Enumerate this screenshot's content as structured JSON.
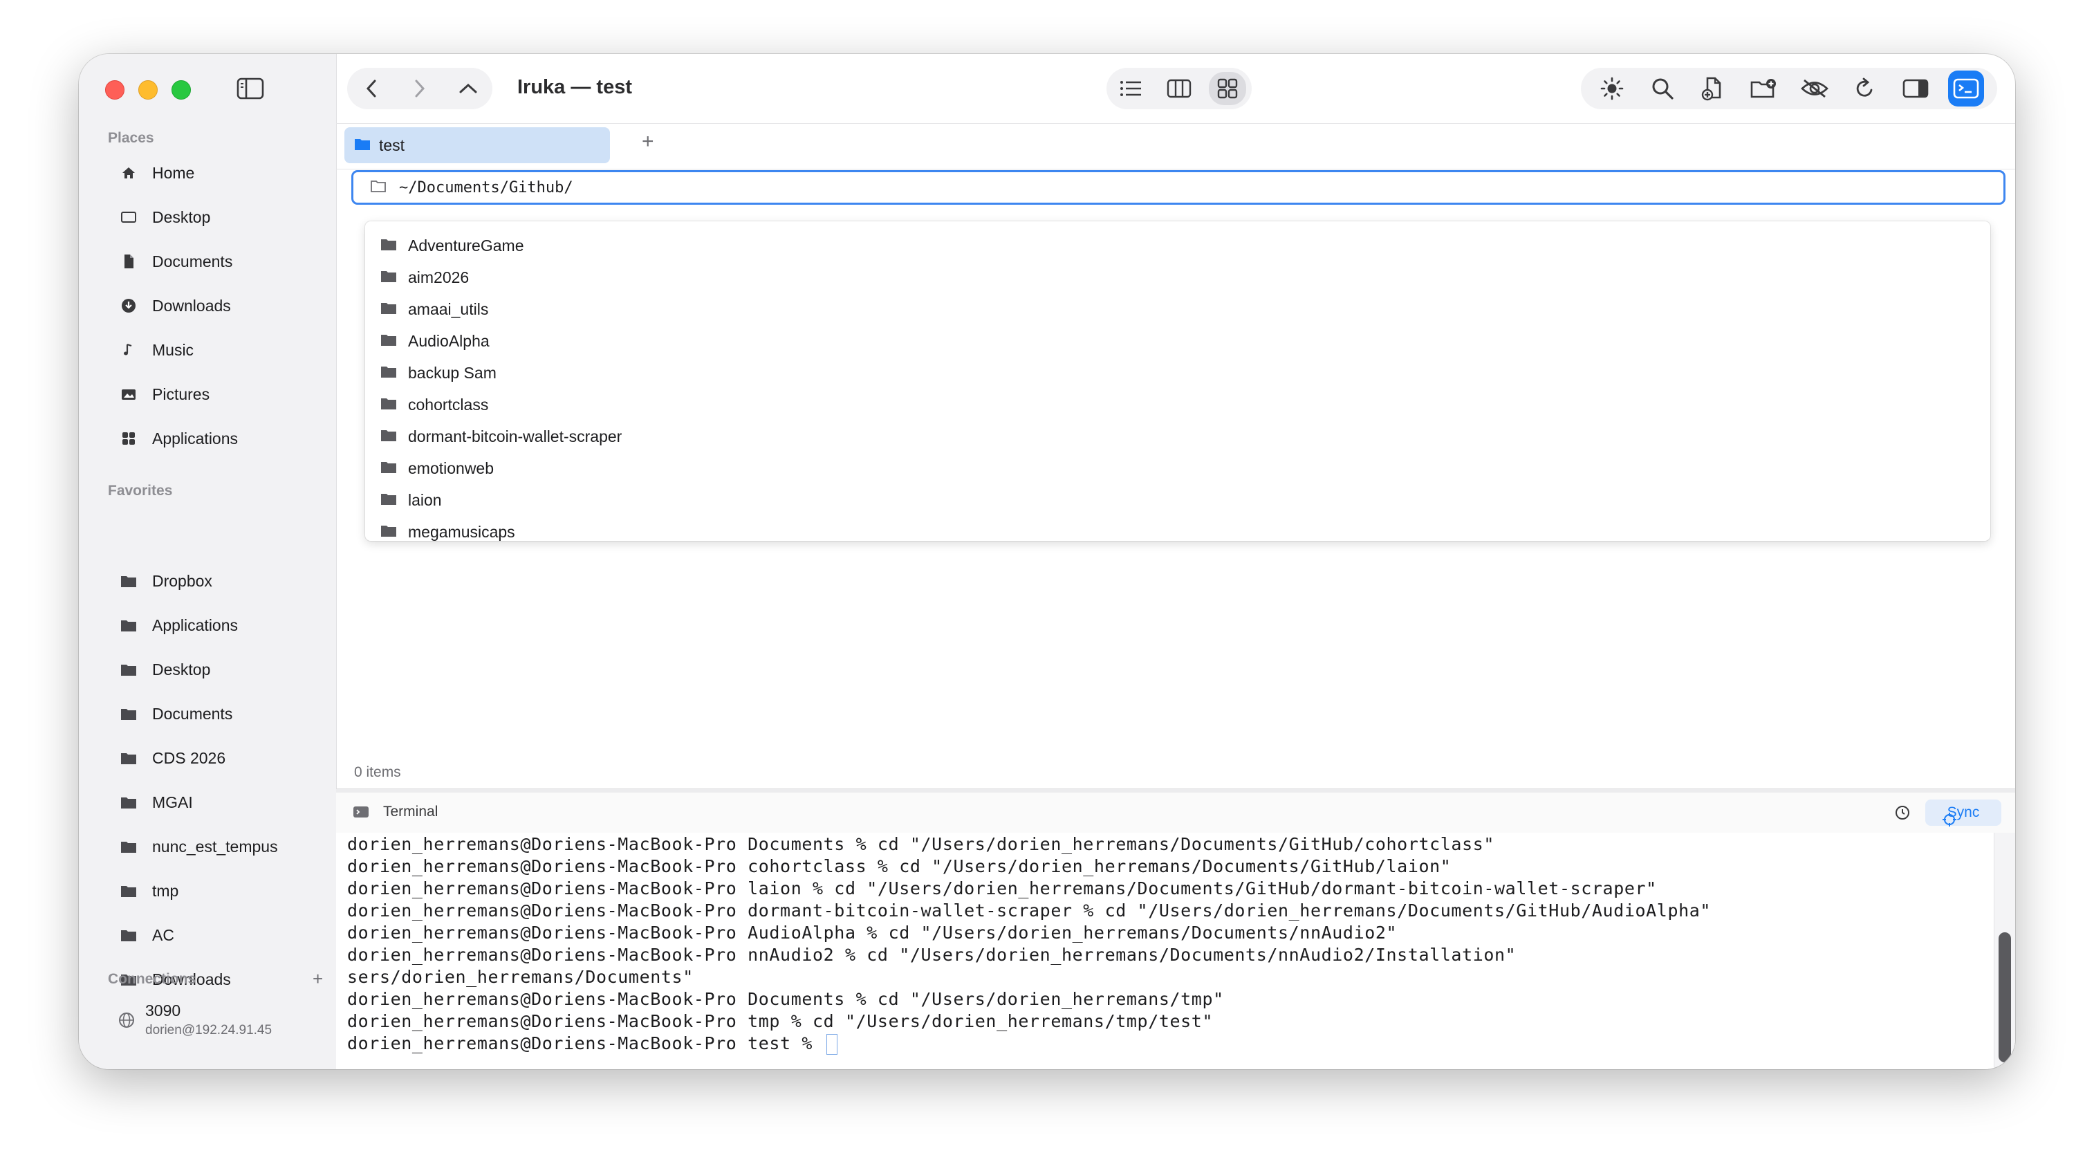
{
  "window": {
    "title": "Iruka — test"
  },
  "sidebar": {
    "places_title": "Places",
    "places": [
      {
        "label": "Home",
        "icon": "home-icon"
      },
      {
        "label": "Desktop",
        "icon": "desktop-icon"
      },
      {
        "label": "Documents",
        "icon": "document-icon"
      },
      {
        "label": "Downloads",
        "icon": "download-icon"
      },
      {
        "label": "Music",
        "icon": "music-icon"
      },
      {
        "label": "Pictures",
        "icon": "pictures-icon"
      },
      {
        "label": "Applications",
        "icon": "applications-icon"
      }
    ],
    "favorites_title": "Favorites",
    "favorites": [
      {
        "label": "Dropbox"
      },
      {
        "label": "Applications"
      },
      {
        "label": "Desktop"
      },
      {
        "label": "Documents"
      },
      {
        "label": "CDS 2026"
      },
      {
        "label": "MGAI"
      },
      {
        "label": "nunc_est_tempus"
      },
      {
        "label": "tmp"
      },
      {
        "label": "AC"
      },
      {
        "label": "Downloads"
      }
    ],
    "connections_title": "Connections",
    "connections_add": "+",
    "connection": {
      "name": "3090",
      "address": "dorien@192.24.91.45"
    }
  },
  "tabs": [
    {
      "label": "test"
    }
  ],
  "tab_add": "+",
  "path": {
    "value": "~/Documents/Github/"
  },
  "suggestions": [
    "AdventureGame",
    "aim2026",
    "amaai_utils",
    "AudioAlpha",
    "backup Sam",
    "cohortclass",
    "dormant-bitcoin-wallet-scraper",
    "emotionweb",
    "laion",
    "megamusicaps"
  ],
  "status": {
    "item_count": "0 items"
  },
  "terminal": {
    "title": "Terminal",
    "sync_label": "Sync",
    "lines": [
      "dorien_herremans@Doriens-MacBook-Pro Documents % cd \"/Users/dorien_herremans/Documents/GitHub/cohortclass\"",
      "dorien_herremans@Doriens-MacBook-Pro cohortclass % cd \"/Users/dorien_herremans/Documents/GitHub/laion\"",
      "dorien_herremans@Doriens-MacBook-Pro laion % cd \"/Users/dorien_herremans/Documents/GitHub/dormant-bitcoin-wallet-scraper\"",
      "dorien_herremans@Doriens-MacBook-Pro dormant-bitcoin-wallet-scraper % cd \"/Users/dorien_herremans/Documents/GitHub/AudioAlpha\"",
      "dorien_herremans@Doriens-MacBook-Pro AudioAlpha % cd \"/Users/dorien_herremans/Documents/nnAudio2\"",
      "dorien_herremans@Doriens-MacBook-Pro nnAudio2 % cd \"/Users/dorien_herremans/Documents/nnAudio2/Installation\"",
      "sers/dorien_herremans/Documents\"",
      "dorien_herremans@Doriens-MacBook-Pro Documents % cd \"/Users/dorien_herremans/tmp\"",
      "dorien_herremans@Doriens-MacBook-Pro tmp % cd \"/Users/dorien_herremans/tmp/test\"",
      "dorien_herremans@Doriens-MacBook-Pro test % "
    ]
  },
  "colors": {
    "accent": "#1a7cf5",
    "tab_bg": "#cfe1f7",
    "sidebar_bg": "#f2f2f4"
  }
}
